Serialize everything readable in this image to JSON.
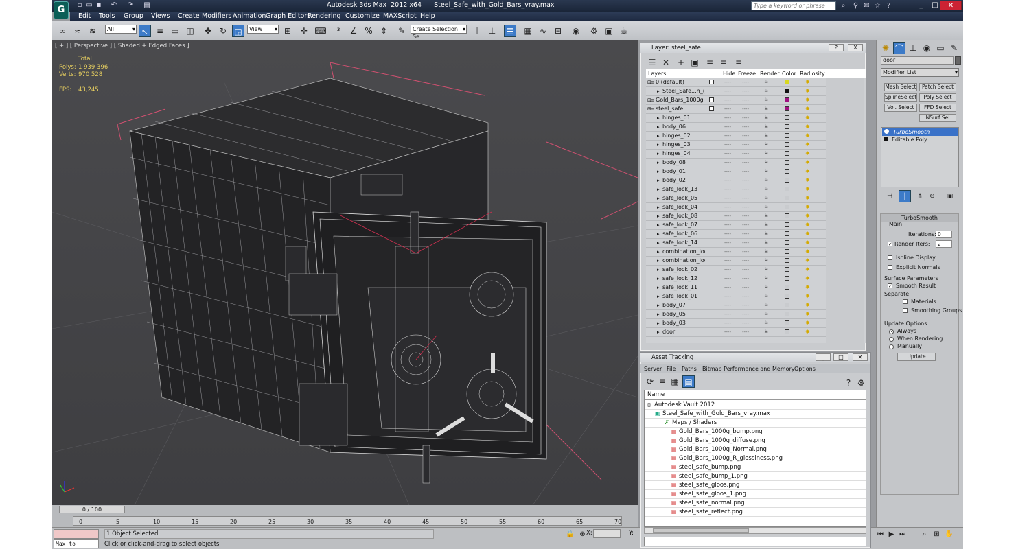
{
  "app": {
    "title": "Autodesk 3ds Max  2012 x64      Steel_Safe_with_Gold_Bars_vray.max",
    "search_placeholder": "Type a keyword or phrase"
  },
  "menu": [
    "Edit",
    "Tools",
    "Group",
    "Views",
    "Create",
    "Modifiers",
    "Animation",
    "Graph Editors",
    "Rendering",
    "Customize",
    "MAXScript",
    "Help"
  ],
  "toolbar": {
    "selection_filter": "All",
    "reference_coord": "View",
    "named_selection": "Create Selection Se"
  },
  "viewport": {
    "label": "[ + ] [ Perspective ] [ Shaded + Edged Faces ]",
    "stats": {
      "total_label": "Total",
      "polys_label": "Polys:",
      "polys_value": "1 939 396",
      "verts_label": "Verts:",
      "verts_value": "970 528",
      "fps_label": "FPS:",
      "fps_value": "43,245"
    }
  },
  "timeline": {
    "frame": "0 / 100",
    "ticks": [
      "0",
      "5",
      "10",
      "15",
      "20",
      "25",
      "30",
      "35",
      "40",
      "45",
      "50",
      "55",
      "60",
      "65",
      "70"
    ]
  },
  "status": {
    "maxscript_label": "Max to Physc.",
    "selected": "1 Object Selected",
    "prompt": "Click or click-and-drag to select objects",
    "x_label": "X:",
    "y_label": "Y:"
  },
  "layer_panel": {
    "title": "Layer: steel_safe",
    "help": "?",
    "close": "X",
    "columns": [
      "Layers",
      "Hide",
      "Freeze",
      "Render",
      "Color",
      "Radiosity"
    ],
    "rows": [
      {
        "name": "0 (default)",
        "type": "layer",
        "color": "#d8d820"
      },
      {
        "name": "Steel_Safe...h_(",
        "type": "object",
        "color": "#111111"
      },
      {
        "name": "Gold_Bars_1000g",
        "type": "layer",
        "color": "#a01080"
      },
      {
        "name": "steel_safe",
        "type": "layer",
        "color": "#a01080"
      },
      {
        "name": "hinges_01",
        "type": "object",
        "color": "#c9cbce"
      },
      {
        "name": "body_06",
        "type": "object",
        "color": "#c9cbce"
      },
      {
        "name": "hinges_02",
        "type": "object",
        "color": "#c9cbce"
      },
      {
        "name": "hinges_03",
        "type": "object",
        "color": "#c9cbce"
      },
      {
        "name": "hinges_04",
        "type": "object",
        "color": "#c9cbce"
      },
      {
        "name": "body_08",
        "type": "object",
        "color": "#c9cbce"
      },
      {
        "name": "body_01",
        "type": "object",
        "color": "#c9cbce"
      },
      {
        "name": "body_02",
        "type": "object",
        "color": "#c9cbce"
      },
      {
        "name": "safe_lock_13",
        "type": "object",
        "color": "#c9cbce"
      },
      {
        "name": "safe_lock_05",
        "type": "object",
        "color": "#c9cbce"
      },
      {
        "name": "safe_lock_04",
        "type": "object",
        "color": "#c9cbce"
      },
      {
        "name": "safe_lock_08",
        "type": "object",
        "color": "#c9cbce"
      },
      {
        "name": "safe_lock_07",
        "type": "object",
        "color": "#c9cbce"
      },
      {
        "name": "safe_lock_06",
        "type": "object",
        "color": "#c9cbce"
      },
      {
        "name": "safe_lock_14",
        "type": "object",
        "color": "#c9cbce"
      },
      {
        "name": "combination_lock",
        "type": "object",
        "color": "#c9cbce"
      },
      {
        "name": "combination_lock",
        "type": "object",
        "color": "#c9cbce"
      },
      {
        "name": "safe_lock_02",
        "type": "object",
        "color": "#c9cbce"
      },
      {
        "name": "safe_lock_12",
        "type": "object",
        "color": "#c9cbce"
      },
      {
        "name": "safe_lock_11",
        "type": "object",
        "color": "#c9cbce"
      },
      {
        "name": "safe_lock_01",
        "type": "object",
        "color": "#c9cbce"
      },
      {
        "name": "body_07",
        "type": "object",
        "color": "#c9cbce"
      },
      {
        "name": "body_05",
        "type": "object",
        "color": "#c9cbce"
      },
      {
        "name": "body_03",
        "type": "object",
        "color": "#c9cbce"
      },
      {
        "name": "door",
        "type": "object",
        "color": "#c9cbce"
      }
    ]
  },
  "asset_panel": {
    "title": "Asset Tracking",
    "menu": [
      "Server",
      "File",
      "Paths",
      "Bitmap Performance and Memory",
      "Options"
    ],
    "column": "Name",
    "rows": [
      "Autodesk Vault 2012",
      "Steel_Safe_with_Gold_Bars_vray.max",
      "Maps / Shaders",
      "Gold_Bars_1000g_bump.png",
      "Gold_Bars_1000g_diffuse.png",
      "Gold_Bars_1000g_Normal.png",
      "Gold_Bars_1000g_R_glossiness.png",
      "steel_safe_bump.png",
      "steel_safe_bump_1.png",
      "steel_safe_gloos.png",
      "steel_safe_gloos_1.png",
      "steel_safe_normal.png",
      "steel_safe_reflect.png"
    ]
  },
  "command_panel": {
    "object_name": "door",
    "modifier_list": "Modifier List",
    "buttons": [
      "Mesh Select",
      "Patch Select",
      "SplineSelect",
      "Poly Select",
      "Vol. Select",
      "FFD Select",
      "NSurf Sel"
    ],
    "stack": [
      "TurboSmooth",
      "Editable Poly"
    ],
    "turbosmooth": {
      "title": "TurboSmooth",
      "main": "Main",
      "iterations_label": "Iterations:",
      "iterations": "0",
      "render_iters_label": "Render Iters:",
      "render_iters": "2",
      "isoline": "Isoline Display",
      "explicit": "Explicit Normals",
      "surface": "Surface Parameters",
      "smooth_result": "Smooth Result",
      "separate": "Separate",
      "materials": "Materials",
      "smoothing_groups": "Smoothing Groups",
      "update_options": "Update Options",
      "always": "Always",
      "when_rendering": "When Rendering",
      "manually": "Manually",
      "update": "Update"
    }
  }
}
